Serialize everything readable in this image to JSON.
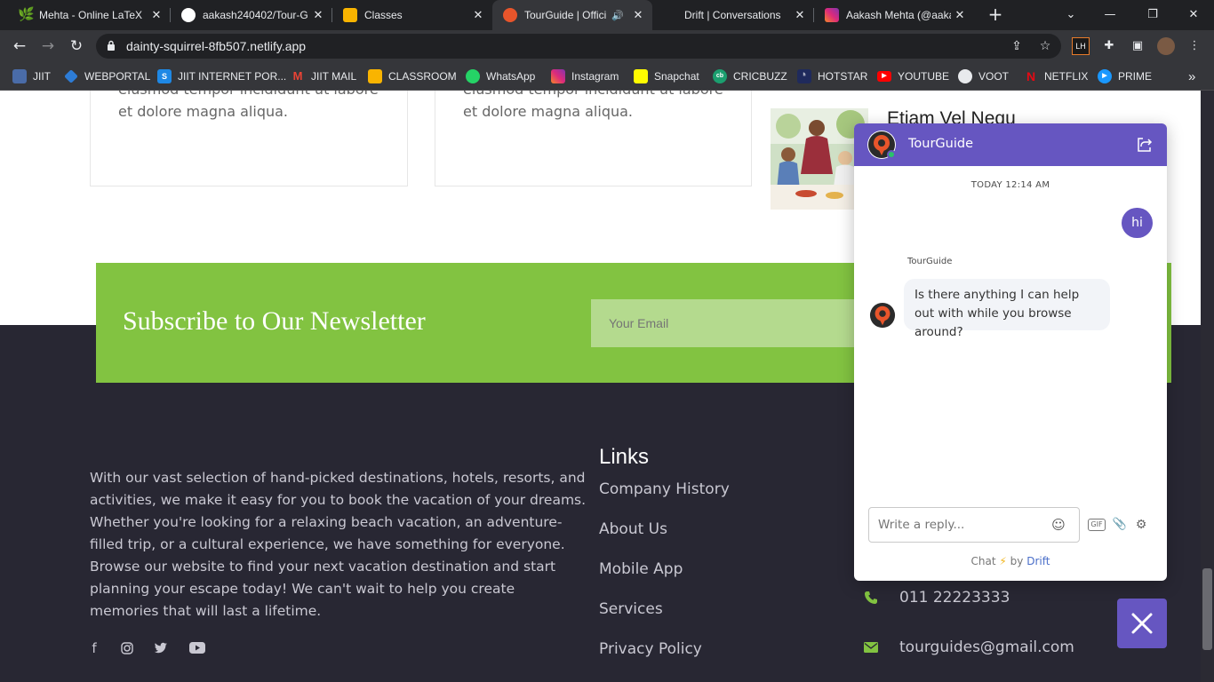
{
  "browser": {
    "tabs": [
      {
        "title": "Mehta - Online LaTeX",
        "icon": "overleaf-icon",
        "color": "#47a141"
      },
      {
        "title": "aakash240402/Tour-G",
        "icon": "github-icon",
        "color": "#ffffff"
      },
      {
        "title": "Classes",
        "icon": "classroom-icon",
        "color": "#f9b400"
      },
      {
        "title": "TourGuide | Offici",
        "icon": "tourguide-icon",
        "color": "#e8552b",
        "active": true
      },
      {
        "title": "Drift | Conversations",
        "icon": "drift-icon",
        "color": "#202124"
      },
      {
        "title": "Aakash Mehta (@aaka",
        "icon": "instagram-icon",
        "color": "#d62976"
      }
    ],
    "url": "dainty-squirrel-8fb507.netlify.app",
    "bookmarks": [
      {
        "label": "JIIT",
        "icon": "jiit-icon",
        "color": "#4a6ca8"
      },
      {
        "label": "WEBPORTAL",
        "icon": "webportal-icon",
        "color": "#2d7cd6"
      },
      {
        "label": "JIIT INTERNET POR...",
        "icon": "portal-s-icon",
        "color": "#1e88e5"
      },
      {
        "label": "JIIT MAIL",
        "icon": "gmail-icon",
        "color": "#ea4335"
      },
      {
        "label": "CLASSROOM",
        "icon": "classroom-icon",
        "color": "#f9b400"
      },
      {
        "label": "WhatsApp",
        "icon": "whatsapp-icon",
        "color": "#25d366"
      },
      {
        "label": "Instagram",
        "icon": "instagram-icon",
        "color": "#d62976"
      },
      {
        "label": "Snapchat",
        "icon": "snapchat-icon",
        "color": "#fffc00"
      },
      {
        "label": "CRICBUZZ",
        "icon": "cricbuzz-icon",
        "color": "#1b9f6f"
      },
      {
        "label": "HOTSTAR",
        "icon": "hotstar-icon",
        "color": "#1f2a5c"
      },
      {
        "label": "YOUTUBE",
        "icon": "youtube-icon",
        "color": "#ff0000"
      },
      {
        "label": "VOOT",
        "icon": "voot-icon",
        "color": "#4a4a4a"
      },
      {
        "label": "NETFLIX",
        "icon": "netflix-icon",
        "color": "#e50914"
      },
      {
        "label": "PRIME",
        "icon": "prime-icon",
        "color": "#1a98ff"
      }
    ],
    "bookmarks_more": "»"
  },
  "page": {
    "card1_text": "eiusmod tempor incididunt ut labore et dolore magna aliqua.",
    "card2_text": "eiusmod tempor incididunt ut labore et dolore magna aliqua.",
    "side_post_title": "Etiam Vel Nequ",
    "newsletter": {
      "title": "Subscribe to Our Newsletter",
      "email_placeholder": "Your Email"
    },
    "about_text": "With our vast selection of hand-picked destinations, hotels, resorts, and activities, we make it easy for you to book the vacation of your dreams. Whether you're looking for a relaxing beach vacation, an adventure-filled trip, or a cultural experience, we have something for everyone. Browse our website to find your next vacation destination and start planning your escape today! We can't wait to help you create memories that will last a lifetime.",
    "social": [
      "facebook-icon",
      "instagram-icon",
      "twitter-icon",
      "youtube-icon"
    ],
    "links_title": "Links",
    "links": [
      "Company History",
      "About Us",
      "Mobile App",
      "Services",
      "Privacy Policy"
    ],
    "phone": "011 22223333",
    "email": "tourguides@gmail.com"
  },
  "chat": {
    "name": "TourGuide",
    "timestamp": "TODAY 12:14 AM",
    "user_message": "hi",
    "bot_label": "TourGuide",
    "bot_message": "Is there anything I can help out with while you browse around?",
    "reply_placeholder": "Write a reply...",
    "gif_label": "GIF",
    "powered_prefix": "Chat",
    "powered_by": "by",
    "powered_brand": "Drift"
  },
  "colors": {
    "accent": "#6656c1",
    "green": "#82c341",
    "footer": "#282733"
  }
}
